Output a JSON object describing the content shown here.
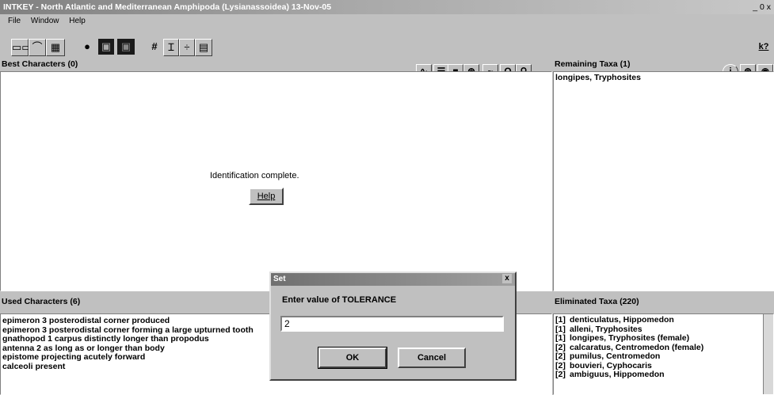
{
  "window": {
    "title": "INTKEY - North Atlantic and Mediterranean Amphipoda (Lysianassoidea) 13-Nov-05",
    "controls": "_ 0 x"
  },
  "menu": [
    "File",
    "Window",
    "Help"
  ],
  "toolbar": {
    "buttons": [
      "grid-icon",
      "taxa-icon",
      "image-icon",
      "restart-icon",
      "dark-icon",
      "dark2-icon",
      "hash-icon",
      "text-icon",
      "plus-minus-icon",
      "doc-icon"
    ],
    "symbols": [
      "▭▭",
      "⌒",
      "▦",
      "●",
      "▣",
      "▣",
      "#",
      "Ɪ",
      "÷",
      "▤"
    ],
    "help_icon": "k?"
  },
  "best_characters": {
    "title": "Best Characters (0)",
    "message": "Identification complete.",
    "help_label": "Help",
    "icons": [
      "line-chart-icon",
      "list-icon",
      "black-square-icon",
      "diversity-icon",
      "tilde-icon",
      "loop-icon",
      "binoculars-icon"
    ],
    "icon_glyphs": [
      "∿",
      "☰",
      "■",
      "⊛",
      "~",
      "O",
      "⚲"
    ]
  },
  "remaining_taxa": {
    "title": "Remaining Taxa (1)",
    "items": [
      "longipes, Tryphosites"
    ],
    "icons": [
      "info-icon",
      "taxa-icon",
      "eye-icon",
      "binoculars-icon"
    ],
    "icon_glyphs": [
      "i",
      "⊛",
      "◉",
      "⚲"
    ]
  },
  "used_characters": {
    "title": "Used Characters (6)",
    "items": [
      "epimeron 3 posterodistal corner produced",
      "epimeron 3 posterodistal corner forming a large upturned tooth",
      "gnathopod 1 carpus distinctly longer than propodus",
      "antenna 2 as long as or longer than body",
      "epistome projecting acutely forward",
      "calceoli present"
    ]
  },
  "eliminated_taxa": {
    "title": "Eliminated Taxa (220)",
    "items": [
      {
        "badge": "[1]",
        "name": "denticulatus, Hippomedon"
      },
      {
        "badge": "[1]",
        "name": "alleni, Tryphosites"
      },
      {
        "badge": "[1]",
        "name": "longipes, Tryphosites (female)"
      },
      {
        "badge": "[2]",
        "name": "calcaratus, Centromedon (female)"
      },
      {
        "badge": "[2]",
        "name": "pumilus, Centromedon"
      },
      {
        "badge": "[2]",
        "name": "bouvieri, Cyphocaris"
      },
      {
        "badge": "[2]",
        "name": "ambiguus, Hippomedon"
      }
    ]
  },
  "dialog": {
    "title": "Set",
    "close": "x",
    "prompt": "Enter value of TOLERANCE",
    "value": "2",
    "ok_label": "OK",
    "cancel_label": "Cancel"
  }
}
